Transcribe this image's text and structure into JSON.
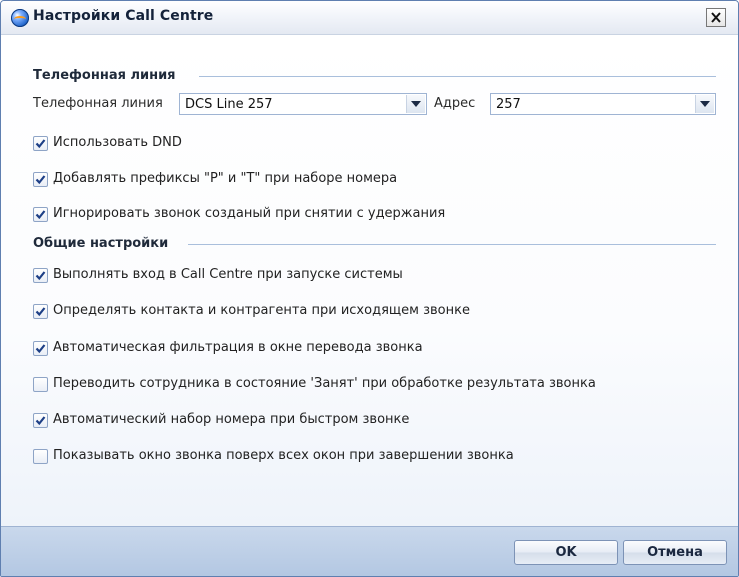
{
  "window": {
    "title": "Настройки Call Centre"
  },
  "phone_group": {
    "title": "Телефонная линия",
    "line_label": "Телефонная линия",
    "line_value": "DCS Line 257",
    "address_label": "Адрес",
    "address_value": "257",
    "options": [
      {
        "label": "Использовать DND",
        "checked": true
      },
      {
        "label": "Добавлять префиксы \"P\" и \"T\"  при наборе номера",
        "checked": true
      },
      {
        "label": "Игнорировать звонок созданый при снятии с удержания",
        "checked": true
      }
    ]
  },
  "general_group": {
    "title": "Общие настройки",
    "options": [
      {
        "label": "Выполнять вход в Call Centre при запуске системы",
        "checked": true
      },
      {
        "label": "Определять контакта и контрагента при исходящем звонке",
        "checked": true
      },
      {
        "label": "Автоматическая фильтрация в окне перевода звонка",
        "checked": true
      },
      {
        "label": "Переводить сотрудника в состояние 'Занят' при обработке результата звонка",
        "checked": false
      },
      {
        "label": "Автоматический набор номера при быстром звонке",
        "checked": true
      },
      {
        "label": "Показывать окно звонка поверх всех окон при завершении звонка",
        "checked": false
      }
    ]
  },
  "buttons": {
    "ok": "OK",
    "cancel": "Отмена"
  },
  "icons": {
    "app": "call-centre-globe-icon",
    "close": "close-icon",
    "dropdown": "chevron-down-icon",
    "check": "checkmark-icon"
  },
  "colors": {
    "accent": "#1e63c8",
    "footer": "#b3c7e2"
  }
}
